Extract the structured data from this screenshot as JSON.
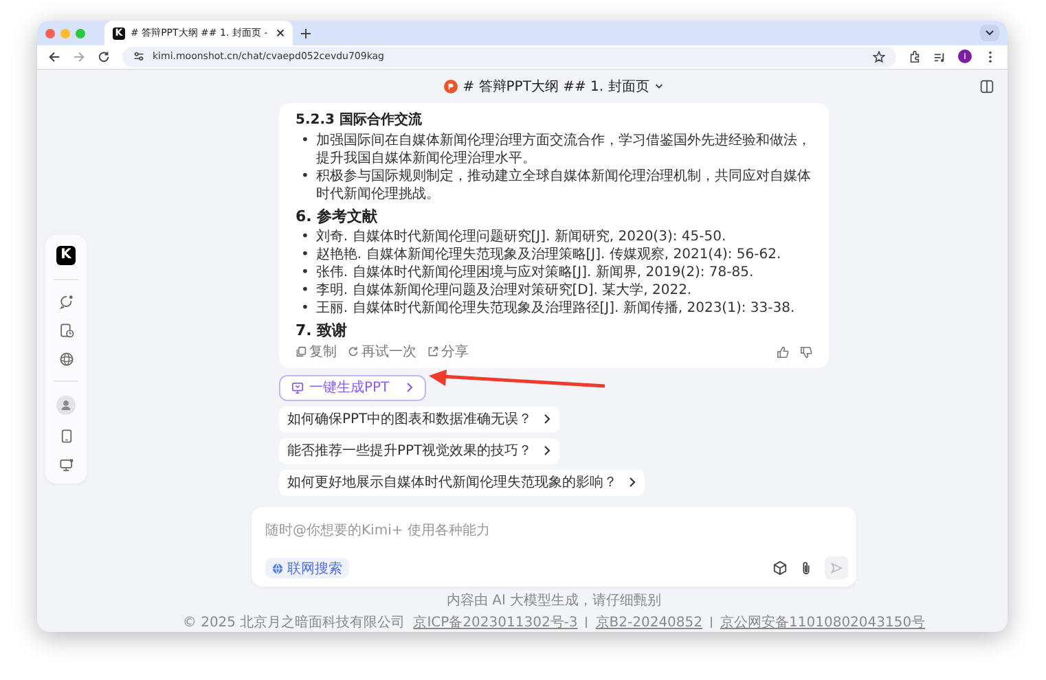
{
  "browser": {
    "tab_title": "# 答辩PPT大纲 ## 1. 封面页 -",
    "url": "kimi.moonshot.cn/chat/cvaepd052cevdu709kag",
    "profile": "I",
    "favicon": "K"
  },
  "header": {
    "title": "# 答辩PPT大纲 ## 1. 封面页"
  },
  "sidebar": {
    "logo": "K"
  },
  "message": {
    "blocks": [
      {
        "kind": "subheading",
        "text": "5.2.3 国际合作交流"
      },
      {
        "kind": "list",
        "marker": "•",
        "items": [
          "加强国际间在自媒体新闻伦理治理方面交流合作，学习借鉴国外先进经验和做法，提升我国自媒体新闻伦理治理水平。",
          "积极参与国际规则制定，推动建立全球自媒体新闻伦理治理机制，共同应对自媒体时代新闻伦理挑战。"
        ]
      },
      {
        "kind": "heading",
        "text": "6. 参考文献"
      },
      {
        "kind": "list",
        "marker": "•",
        "items": [
          "刘奇. 自媒体时代新闻伦理问题研究[J]. 新闻研究, 2020(3): 45-50.",
          "赵艳艳. 自媒体新闻伦理失范现象及治理策略[J]. 传媒观察, 2021(4): 56-62.",
          "张伟. 自媒体时代新闻伦理困境与应对策略[J]. 新闻界, 2019(2): 78-85.",
          "李明. 自媒体新闻伦理问题及治理对策研究[D]. 某大学, 2022.",
          "王丽. 自媒体时代新闻伦理失范现象及治理路径[J]. 新闻传播, 2023(1): 33-38."
        ]
      },
      {
        "kind": "heading",
        "text": "7. 致谢"
      }
    ],
    "actions": [
      "复制",
      "再试一次",
      "分享"
    ]
  },
  "ppt_button": "一键生成PPT",
  "suggestions": [
    "如何确保PPT中的图表和数据准确无误？",
    "能否推荐一些提升PPT视觉效果的技巧？",
    "如何更好地展示自媒体时代新闻伦理失范现象的影响？"
  ],
  "input": {
    "placeholder": "随时@你想要的Kimi+ 使用各种能力",
    "search_chip": "联网搜索"
  },
  "footer": {
    "notice": "内容由 AI 大模型生成，请仔细甄别",
    "copyright": "© 2025 北京月之暗面科技有限公司",
    "links": [
      "京ICP备2023011302号-3",
      "京B2-20240852",
      "京公网安备11010802043150号"
    ]
  }
}
